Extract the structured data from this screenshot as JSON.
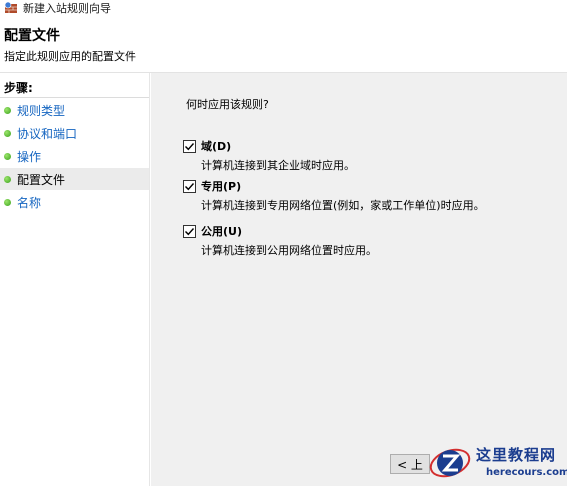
{
  "window": {
    "title": "新建入站规则向导",
    "icon": "firewall-wizard-icon"
  },
  "header": {
    "title": "配置文件",
    "subtitle": "指定此规则应用的配置文件"
  },
  "sidebar": {
    "steps_label": "步骤:",
    "items": [
      {
        "label": "规则类型",
        "active": false
      },
      {
        "label": "协议和端口",
        "active": false
      },
      {
        "label": "操作",
        "active": false
      },
      {
        "label": "配置文件",
        "active": true
      },
      {
        "label": "名称",
        "active": false
      }
    ]
  },
  "main": {
    "question": "何时应用该规则?",
    "options": [
      {
        "label": "域(D)",
        "checked": true,
        "description": "计算机连接到其企业域时应用。"
      },
      {
        "label": "专用(P)",
        "checked": true,
        "description": "计算机连接到专用网络位置(例如，家或工作单位)时应用。"
      },
      {
        "label": "公用(U)",
        "checked": true,
        "description": "计算机连接到公用网络位置时应用。"
      }
    ],
    "back_button": "< 上"
  },
  "watermark": {
    "title": "这里教程网",
    "url": "herecours.com"
  },
  "colors": {
    "link": "#1565c0",
    "step_dot": "#3aa11c",
    "panel_bg": "#f0f0f0",
    "watermark": "#1b3d8f",
    "watermark_accent": "#d32f2f"
  }
}
